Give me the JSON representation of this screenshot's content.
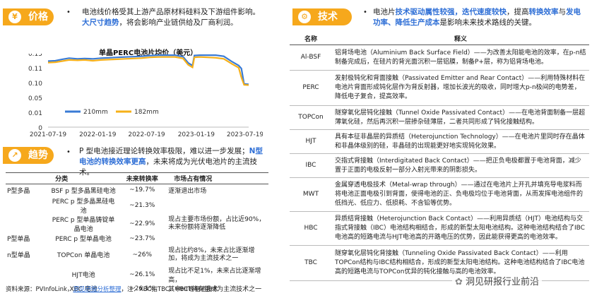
{
  "left": {
    "price_tag": "价格",
    "price_text_1": "电池线价格受其上游产品原材料硅料及下游组件影响。",
    "price_text_hl": "大尺寸趋势",
    "price_text_2": "，将会影响产业链供给及厂商利润。",
    "trend_tag": "趋势",
    "trend_text_1": "P 型电池接近理论转换效率极限，难以进一步发展；",
    "trend_text_hl": "N型电池的转换效率更高",
    "trend_text_2": "，未来将成为光伏电池片的主流技术。",
    "table_headers": [
      "分类",
      "未来转换率",
      "市场占有情况"
    ],
    "table_rows": [
      {
        "group": "P型多晶",
        "name": "BSF p 型多晶黑硅电池",
        "rate": "~19.7%",
        "market": "逐渐退出市场"
      },
      {
        "group": "",
        "name": "PERC p 型多晶黑硅电池",
        "rate": "~21.3%",
        "market": ""
      },
      {
        "group": "",
        "name": "PERC p 型单晶铸锭单晶电池",
        "rate": "~22.9%",
        "market": "现占主要市场份额，占比近90%，未来份额将逐渐降低"
      },
      {
        "group": "P型单晶",
        "name": "PERC p 型单晶电池",
        "rate": "~23.7%",
        "market": ""
      },
      {
        "group": "n型单晶",
        "name": "TOPCon 单晶电池",
        "rate": "~26%",
        "market": "现占比约8%，未来占比逐渐增加，将成为主流技术之一"
      },
      {
        "group": "",
        "name": "HJT电池",
        "rate": "~26.1%",
        "market": "现占比不足1%，未来占比逐渐增高，"
      },
      {
        "group": "",
        "name": "XBC 电池",
        "rate": "~26.1%",
        "market": "其中HIT将有望成为主流技术之一"
      }
    ],
    "source": "资料来源：PVInfoLink，",
    "source_link": "洞见研报分析整理",
    "source_note": "，注：XBC指TBC、HBC等电池技术"
  },
  "chart_data": {
    "type": "line",
    "title": "单晶PERC电池片均价（美元）",
    "xlabel": "",
    "ylabel": "",
    "x_tick_labels": [
      "2021-07-19",
      "2022-01-19",
      "2022-07-19",
      "2023-01-19",
      "2023-07-19"
    ],
    "x_range": [
      "2021-07-19",
      "2023-08-01"
    ],
    "ylim": [
      0,
      0.15
    ],
    "y_tick_labels": [
      "0",
      "0.01",
      "0.05",
      "0.10",
      "0.11",
      "0.15"
    ],
    "legend_position": "bottom",
    "series": [
      {
        "name": "210mm",
        "color": "#3a7bd5",
        "points": [
          [
            "2021-07-19",
            0.13
          ],
          [
            "2021-08-15",
            0.131
          ],
          [
            "2021-09-10",
            0.135
          ],
          [
            "2021-10-05",
            0.138
          ],
          [
            "2021-11-05",
            0.136
          ],
          [
            "2021-12-01",
            0.137
          ],
          [
            "2022-01-01",
            0.136
          ],
          [
            "2022-02-01",
            0.138
          ],
          [
            "2022-03-01",
            0.139
          ],
          [
            "2022-04-01",
            0.14
          ],
          [
            "2022-05-01",
            0.141
          ],
          [
            "2022-06-01",
            0.142
          ],
          [
            "2022-07-01",
            0.143
          ],
          [
            "2022-08-01",
            0.145
          ],
          [
            "2022-09-01",
            0.146
          ],
          [
            "2022-10-01",
            0.146
          ],
          [
            "2022-11-01",
            0.146
          ],
          [
            "2022-12-01",
            0.142
          ],
          [
            "2022-12-20",
            0.125
          ],
          [
            "2023-01-05",
            0.118
          ],
          [
            "2023-01-12",
            0.145
          ],
          [
            "2023-02-01",
            0.146
          ],
          [
            "2023-03-01",
            0.146
          ],
          [
            "2023-04-01",
            0.146
          ],
          [
            "2023-05-01",
            0.143
          ],
          [
            "2023-06-01",
            0.128
          ],
          [
            "2023-06-25",
            0.118
          ],
          [
            "2023-07-05",
            0.11
          ],
          [
            "2023-07-15",
            0.098
          ],
          [
            "2023-08-01",
            0.097
          ]
        ]
      },
      {
        "name": "182mm",
        "color": "#f6b019",
        "points": [
          [
            "2021-07-19",
            0.126
          ],
          [
            "2021-08-15",
            0.127
          ],
          [
            "2021-09-10",
            0.13
          ],
          [
            "2021-10-05",
            0.133
          ],
          [
            "2021-11-05",
            0.132
          ],
          [
            "2021-12-01",
            0.133
          ],
          [
            "2022-01-01",
            0.131
          ],
          [
            "2022-02-01",
            0.133
          ],
          [
            "2022-03-01",
            0.134
          ],
          [
            "2022-04-01",
            0.135
          ],
          [
            "2022-05-01",
            0.136
          ],
          [
            "2022-06-01",
            0.137
          ],
          [
            "2022-07-01",
            0.138
          ],
          [
            "2022-08-01",
            0.14
          ],
          [
            "2022-09-01",
            0.141
          ],
          [
            "2022-10-01",
            0.141
          ],
          [
            "2022-11-01",
            0.141
          ],
          [
            "2022-12-01",
            0.137
          ],
          [
            "2022-12-20",
            0.12
          ],
          [
            "2023-01-05",
            0.113
          ],
          [
            "2023-01-12",
            0.14
          ],
          [
            "2023-02-01",
            0.141
          ],
          [
            "2023-03-01",
            0.14
          ],
          [
            "2023-04-01",
            0.139
          ],
          [
            "2023-05-01",
            0.136
          ],
          [
            "2023-06-01",
            0.122
          ],
          [
            "2023-06-25",
            0.112
          ],
          [
            "2023-07-05",
            0.104
          ],
          [
            "2023-07-15",
            0.095
          ],
          [
            "2023-08-01",
            0.094
          ]
        ]
      }
    ]
  },
  "right": {
    "tech_tag": "技术",
    "tech_text_1": "电池片",
    "tech_text_hl1": "技术驱动属性较强",
    "tech_text_sep": "，",
    "tech_text_hl2": "迭代速度较快",
    "tech_text_2": "，提高",
    "tech_text_hl3": "转换效率",
    "tech_text_3": "与",
    "tech_text_hl4": "发电功率",
    "tech_text_sep2": "、",
    "tech_text_hl5": "降低生产成本",
    "tech_text_4": "是影响未来技术路线的关键。",
    "table_headers": [
      "名称",
      "释义"
    ],
    "rows": [
      {
        "name": "Al-BSF",
        "desc": "铝背场电池（Aluminium Back Surface Field）——为改善太阳能电池的效率，在p-n结制备完成后，在硅片的背光面沉积一层铝膜，制备P+层，称为铝背场电池。"
      },
      {
        "name": "PERC",
        "desc": "发射极钝化和背面接触（Passivated Emitter and Rear Contact）——利用特殊材料在电池片背面形成钝化层作为背反射器，增加长波光的吸收，同时增大p-n极间的电势差，降低电子复合，提高效率。"
      },
      {
        "name": "TOPCon",
        "desc": "隧穿氧化层钝化接触（Tunnel Oxide Passivated Contact）——在电池背面制备一层超薄氧化硅，然后再沉积一层掺杂硅薄层，二者共同形成了钝化接触结构。"
      },
      {
        "name": "HJT",
        "desc": "具有本征非晶层的异质结（Heterojunction Technology）——在电池片里同时存在晶体和非晶体级别的硅，非晶硅的出现能更好地实现钝化效果。"
      },
      {
        "name": "IBC",
        "desc": "交指式背接触（Interdigitated Back Contact）——把正负电极都置于电池背面，减少置于正面的电极反射一部分入射光带来的阴影损失。"
      },
      {
        "name": "MWT",
        "desc": "金属穿透电极技术（Metal-wrap through）——通过在电池片上开孔并填充导电浆料而将电池正面电极引到背面，使得电池的正、负电极均位于电池背面，从而发挥电池组件的低挡光、低应力、低损耗、不含铅等优势。"
      },
      {
        "name": "HBC",
        "desc": "异质结背接触（Heterojunction Back Contact）——利用异质结（HJT）电池结构与交指式背接触（IBC）电池结构相结合，形成的新型太阳电池结构。这种电池结构结合了IBC电池高的短路电流与HJT电池高的开路电压的优势，因此能获得更高的电池效率。"
      },
      {
        "name": "TBC",
        "desc": "隧穿氧化层钝化背接触（Tunneling Oxide Passivated Back Contact）——利用TOPCon结构与IBC结构相结合，形成的新型太阳电池结构。这种电池结构结合了IBC电池高的短路电流与TOPCon优异的钝化接触与高的电池效率。"
      }
    ],
    "watermark": "洞见研报行业前沿"
  }
}
